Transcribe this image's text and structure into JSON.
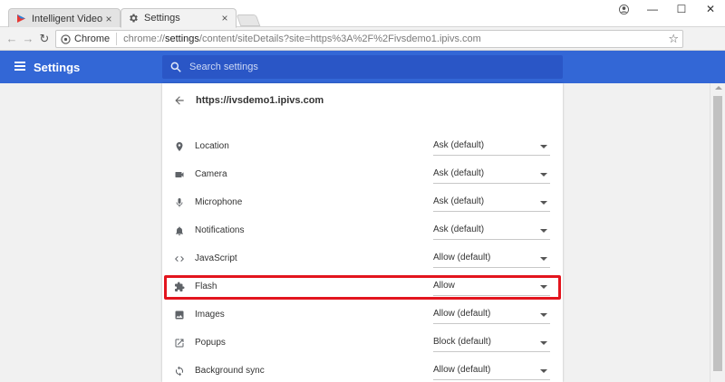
{
  "browser": {
    "tabs": [
      {
        "title": "Intelligent Video Solutio",
        "close": "×"
      },
      {
        "title": "Settings",
        "close": "×"
      }
    ],
    "window_controls": {
      "minimize": "—",
      "maximize": "☐",
      "close": "✕"
    },
    "omnibox": {
      "chip": "Chrome",
      "url_scheme": "chrome://",
      "url_host": "settings",
      "url_rest": "/content/siteDetails?site=https%3A%2F%2Fivsdemo1.ipivs.com"
    }
  },
  "header": {
    "title": "Settings",
    "search_placeholder": "Search settings"
  },
  "site_details": {
    "site": "https://ivsdemo1.ipivs.com",
    "permissions": [
      {
        "label": "Location",
        "value": "Ask (default)",
        "icon": "location-pin-icon"
      },
      {
        "label": "Camera",
        "value": "Ask (default)",
        "icon": "camera-icon"
      },
      {
        "label": "Microphone",
        "value": "Ask (default)",
        "icon": "microphone-icon"
      },
      {
        "label": "Notifications",
        "value": "Ask (default)",
        "icon": "bell-icon"
      },
      {
        "label": "JavaScript",
        "value": "Allow (default)",
        "icon": "code-brackets-icon"
      },
      {
        "label": "Flash",
        "value": "Allow",
        "icon": "puzzle-piece-icon",
        "highlighted": true
      },
      {
        "label": "Images",
        "value": "Allow (default)",
        "icon": "image-icon"
      },
      {
        "label": "Popups",
        "value": "Block (default)",
        "icon": "open-in-new-icon"
      },
      {
        "label": "Background sync",
        "value": "Allow (default)",
        "icon": "sync-icon"
      }
    ]
  },
  "colors": {
    "header_blue": "#3367d6",
    "search_blue": "#2a56c6",
    "highlight_red": "#e3151e"
  }
}
